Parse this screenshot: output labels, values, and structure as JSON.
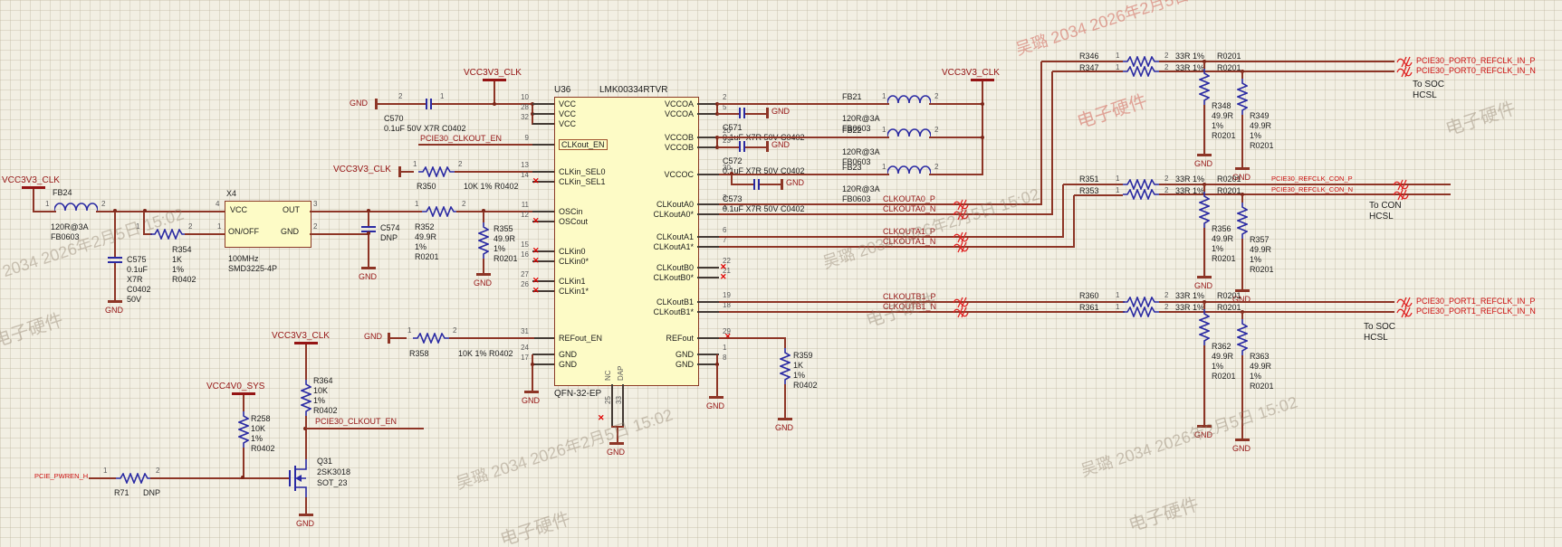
{
  "watermark": {
    "line1": "吴璐 2034 2026年2月5日 15:02",
    "line2": "电子硬件"
  },
  "pins": {
    "p1": "1",
    "p2": "2",
    "p3": "3",
    "p4": "4"
  },
  "nets": {
    "vcc3v3_clk": "VCC3V3_CLK",
    "vcc4v0_sys": "VCC4V0_SYS",
    "gnd": "GND",
    "pcie30_clkout_en": "PCIE30_CLKOUT_EN",
    "pcie_pwren_h": "PCIE_PWREN_H",
    "clkouta0_p": "CLKOUTA0_P",
    "clkouta0_n": "CLKOUTA0_N",
    "clkouta1_p": "CLKOUTA1_P",
    "clkouta1_n": "CLKOUTA1_N",
    "clkoutb1_p": "CLKOUTB1_P",
    "clkoutb1_n": "CLKOUTB1_N",
    "port0_p": "PCIE30_PORT0_REFCLK_IN_P",
    "port0_n": "PCIE30_PORT0_REFCLK_IN_N",
    "con_p": "PCIE30_REFCLK_CON_P",
    "con_n": "PCIE30_REFCLK_CON_N",
    "port1_p": "PCIE30_PORT1_REFCLK_IN_P",
    "port1_n": "PCIE30_PORT1_REFCLK_IN_N"
  },
  "notes": {
    "to_soc": "To SOC",
    "to_con": "To CON",
    "hcsl": "HCSL"
  },
  "ic": {
    "ref": "U36",
    "part": "LMK00334RTVR",
    "footprint": "QFN-32-EP",
    "left_pins": [
      {
        "n": "10",
        "name": "VCC"
      },
      {
        "n": "28",
        "name": "VCC"
      },
      {
        "n": "32",
        "name": "VCC"
      },
      {
        "n": "9",
        "name": "CLKout_EN"
      },
      {
        "n": "13",
        "name": "CLKin_SEL0"
      },
      {
        "n": "14",
        "name": "CLKin_SEL1"
      },
      {
        "n": "11",
        "name": "OSCin"
      },
      {
        "n": "12",
        "name": "OSCout"
      },
      {
        "n": "15",
        "name": "CLKin0"
      },
      {
        "n": "16",
        "name": "CLKin0*"
      },
      {
        "n": "27",
        "name": "CLKin1"
      },
      {
        "n": "26",
        "name": "CLKin1*"
      },
      {
        "n": "31",
        "name": "REFout_EN"
      },
      {
        "n": "24",
        "name": "GND"
      },
      {
        "n": "17",
        "name": "GND"
      }
    ],
    "right_pins": [
      {
        "n": "2",
        "name": "VCCOA"
      },
      {
        "n": "5",
        "name": "VCCOA"
      },
      {
        "n": "20",
        "name": "VCCOB"
      },
      {
        "n": "23",
        "name": "VCCOB"
      },
      {
        "n": "30",
        "name": "VCCOC"
      },
      {
        "n": "3",
        "name": "CLKoutA0"
      },
      {
        "n": "4",
        "name": "CLKoutA0*"
      },
      {
        "n": "6",
        "name": "CLKoutA1"
      },
      {
        "n": "7",
        "name": "CLKoutA1*"
      },
      {
        "n": "22",
        "name": "CLKoutB0"
      },
      {
        "n": "21",
        "name": "CLKoutB0*"
      },
      {
        "n": "19",
        "name": "CLKoutB1"
      },
      {
        "n": "18",
        "name": "CLKoutB1*"
      },
      {
        "n": "29",
        "name": "REFout"
      },
      {
        "n": "1",
        "name": "GND"
      },
      {
        "n": "8",
        "name": "GND"
      }
    ],
    "bottom_pins": [
      {
        "n": "25",
        "name": "NC"
      },
      {
        "n": "33",
        "name": "DAP"
      }
    ]
  },
  "components": {
    "fb24": {
      "ref": "FB24",
      "value": "120R@3A",
      "fp": "FB0603"
    },
    "c575": {
      "ref": "C575",
      "l1": "0.1uF",
      "l2": "X7R",
      "l3": "C0402",
      "l4": "50V"
    },
    "r354": {
      "ref": "R354",
      "l1": "1K",
      "l2": "1%",
      "l3": "R0402"
    },
    "x4": {
      "ref": "X4",
      "pin_vcc": "VCC",
      "pin_out": "OUT",
      "pin_onoff": "ON/OFF",
      "pin_gnd": "GND",
      "value": "100MHz",
      "fp": "SMD3225-4P"
    },
    "c574": {
      "ref": "C574",
      "value": "DNP"
    },
    "r352": {
      "ref": "R352",
      "l1": "49.9R",
      "l2": "1%",
      "l3": "R0201"
    },
    "r355": {
      "ref": "R355",
      "l1": "49.9R",
      "l2": "1%",
      "l3": "R0201"
    },
    "r350": {
      "ref": "R350",
      "value": "10K 1% R0402"
    },
    "r358": {
      "ref": "R358",
      "value": "10K 1% R0402"
    },
    "c570": {
      "ref": "C570",
      "value": "0.1uF 50V X7R C0402"
    },
    "c571": {
      "ref": "C571",
      "value": "0.1uF X7R 50V C0402"
    },
    "c572": {
      "ref": "C572",
      "value": "0.1uF X7R 50V C0402"
    },
    "c573": {
      "ref": "C573",
      "value": "0.1uF X7R 50V C0402"
    },
    "fb21": {
      "ref": "FB21",
      "value": "120R@3A",
      "fp": "FB0603"
    },
    "fb22": {
      "ref": "FB22",
      "value": "120R@3A",
      "fp": "FB0603"
    },
    "fb23": {
      "ref": "FB23",
      "value": "120R@3A",
      "fp": "FB0603"
    },
    "r346": {
      "ref": "R346",
      "value": "33R 1%",
      "fp": "R0201"
    },
    "r347": {
      "ref": "R347",
      "value": "33R 1%",
      "fp": "R0201"
    },
    "r351": {
      "ref": "R351",
      "value": "33R 1%",
      "fp": "R0201"
    },
    "r353": {
      "ref": "R353",
      "value": "33R 1%",
      "fp": "R0201"
    },
    "r360": {
      "ref": "R360",
      "value": "33R 1%",
      "fp": "R0201"
    },
    "r361": {
      "ref": "R361",
      "value": "33R 1%",
      "fp": "R0201"
    },
    "r348": {
      "ref": "R348",
      "l1": "49.9R",
      "l2": "1%",
      "l3": "R0201"
    },
    "r349": {
      "ref": "R349",
      "l1": "49.9R",
      "l2": "1%",
      "l3": "R0201"
    },
    "r356": {
      "ref": "R356",
      "l1": "49.9R",
      "l2": "1%",
      "l3": "R0201"
    },
    "r357": {
      "ref": "R357",
      "l1": "49.9R",
      "l2": "1%",
      "l3": "R0201"
    },
    "r362": {
      "ref": "R362",
      "l1": "49.9R",
      "l2": "1%",
      "l3": "R0201"
    },
    "r363": {
      "ref": "R363",
      "l1": "49.9R",
      "l2": "1%",
      "l3": "R0201"
    },
    "r364": {
      "ref": "R364",
      "l1": "10K",
      "l2": "1%",
      "l3": "R0402"
    },
    "r258": {
      "ref": "R258",
      "l1": "10K",
      "l2": "1%",
      "l3": "R0402"
    },
    "r359": {
      "ref": "R359",
      "l1": "1K",
      "l2": "1%",
      "l3": "R0402"
    },
    "r71": {
      "ref": "R71",
      "value": "DNP"
    },
    "q31": {
      "ref": "Q31",
      "part": "2SK3018",
      "fp": "SOT_23"
    }
  }
}
